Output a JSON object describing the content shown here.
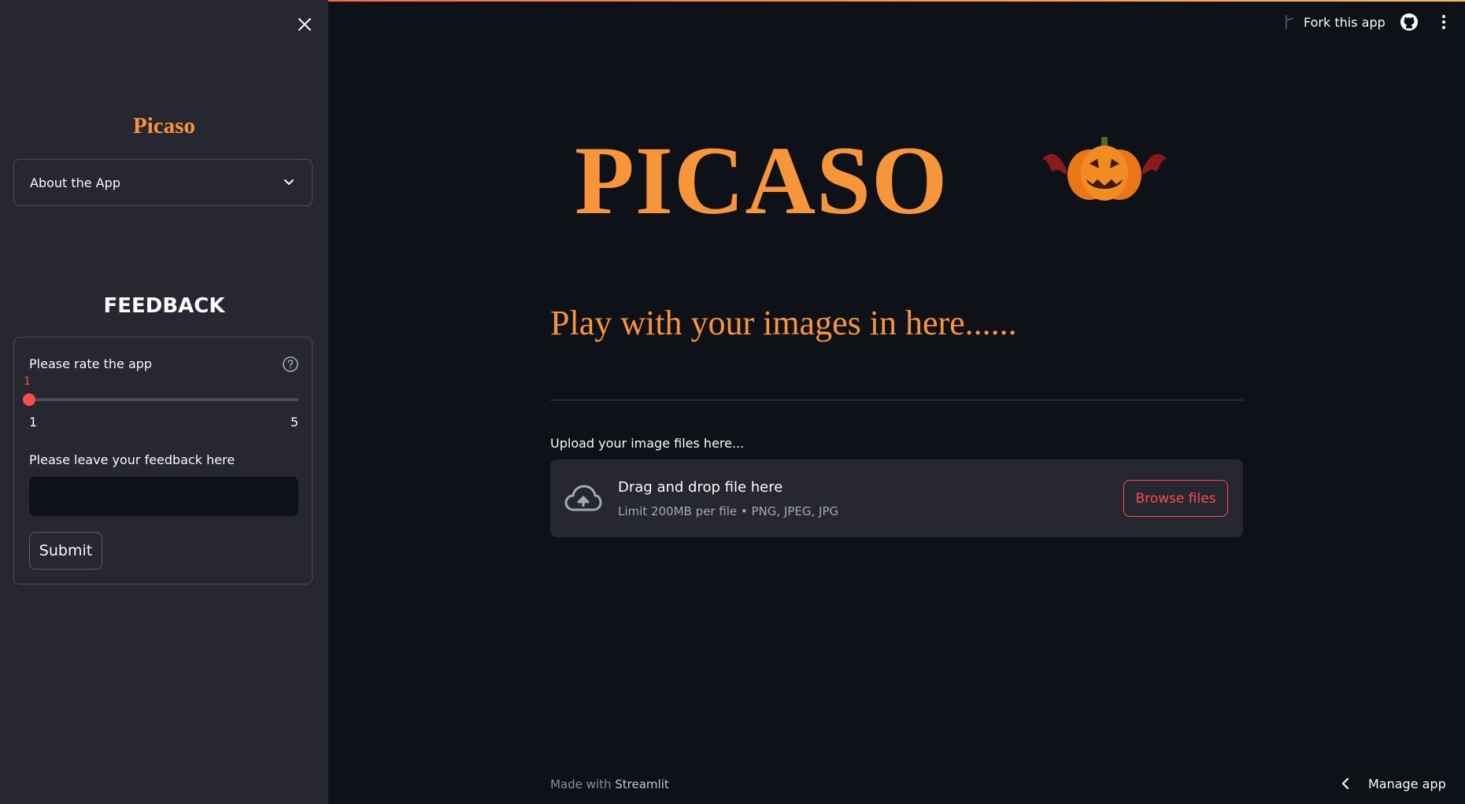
{
  "sidebar": {
    "title": "Picaso",
    "expander_label": "About the App",
    "feedback_heading": "FEEDBACK",
    "form": {
      "rating_label": "Please rate the app",
      "rating_value": "1",
      "rating_min": "1",
      "rating_max": "5",
      "feedback_label": "Please leave your feedback here",
      "feedback_value": "",
      "submit_label": "Submit"
    }
  },
  "header": {
    "fork_label": "Fork this app",
    "github_icon": "github-icon",
    "menu_icon": "kebab-menu-icon"
  },
  "main": {
    "title": "PICASO",
    "subtitle": "Play with your images in here......",
    "upload_label": "Upload your image files here...",
    "dropzone": {
      "title": "Drag and drop file here",
      "limit": "Limit 200MB per file • PNG, JPEG, JPG",
      "browse_label": "Browse files"
    }
  },
  "footer": {
    "made_with": "Made with",
    "brand": "Streamlit",
    "manage_label": "Manage app"
  },
  "colors": {
    "accent": "#f6953a",
    "primary": "#ff4b4b",
    "background": "#0e1117",
    "sidebar": "#262730"
  }
}
